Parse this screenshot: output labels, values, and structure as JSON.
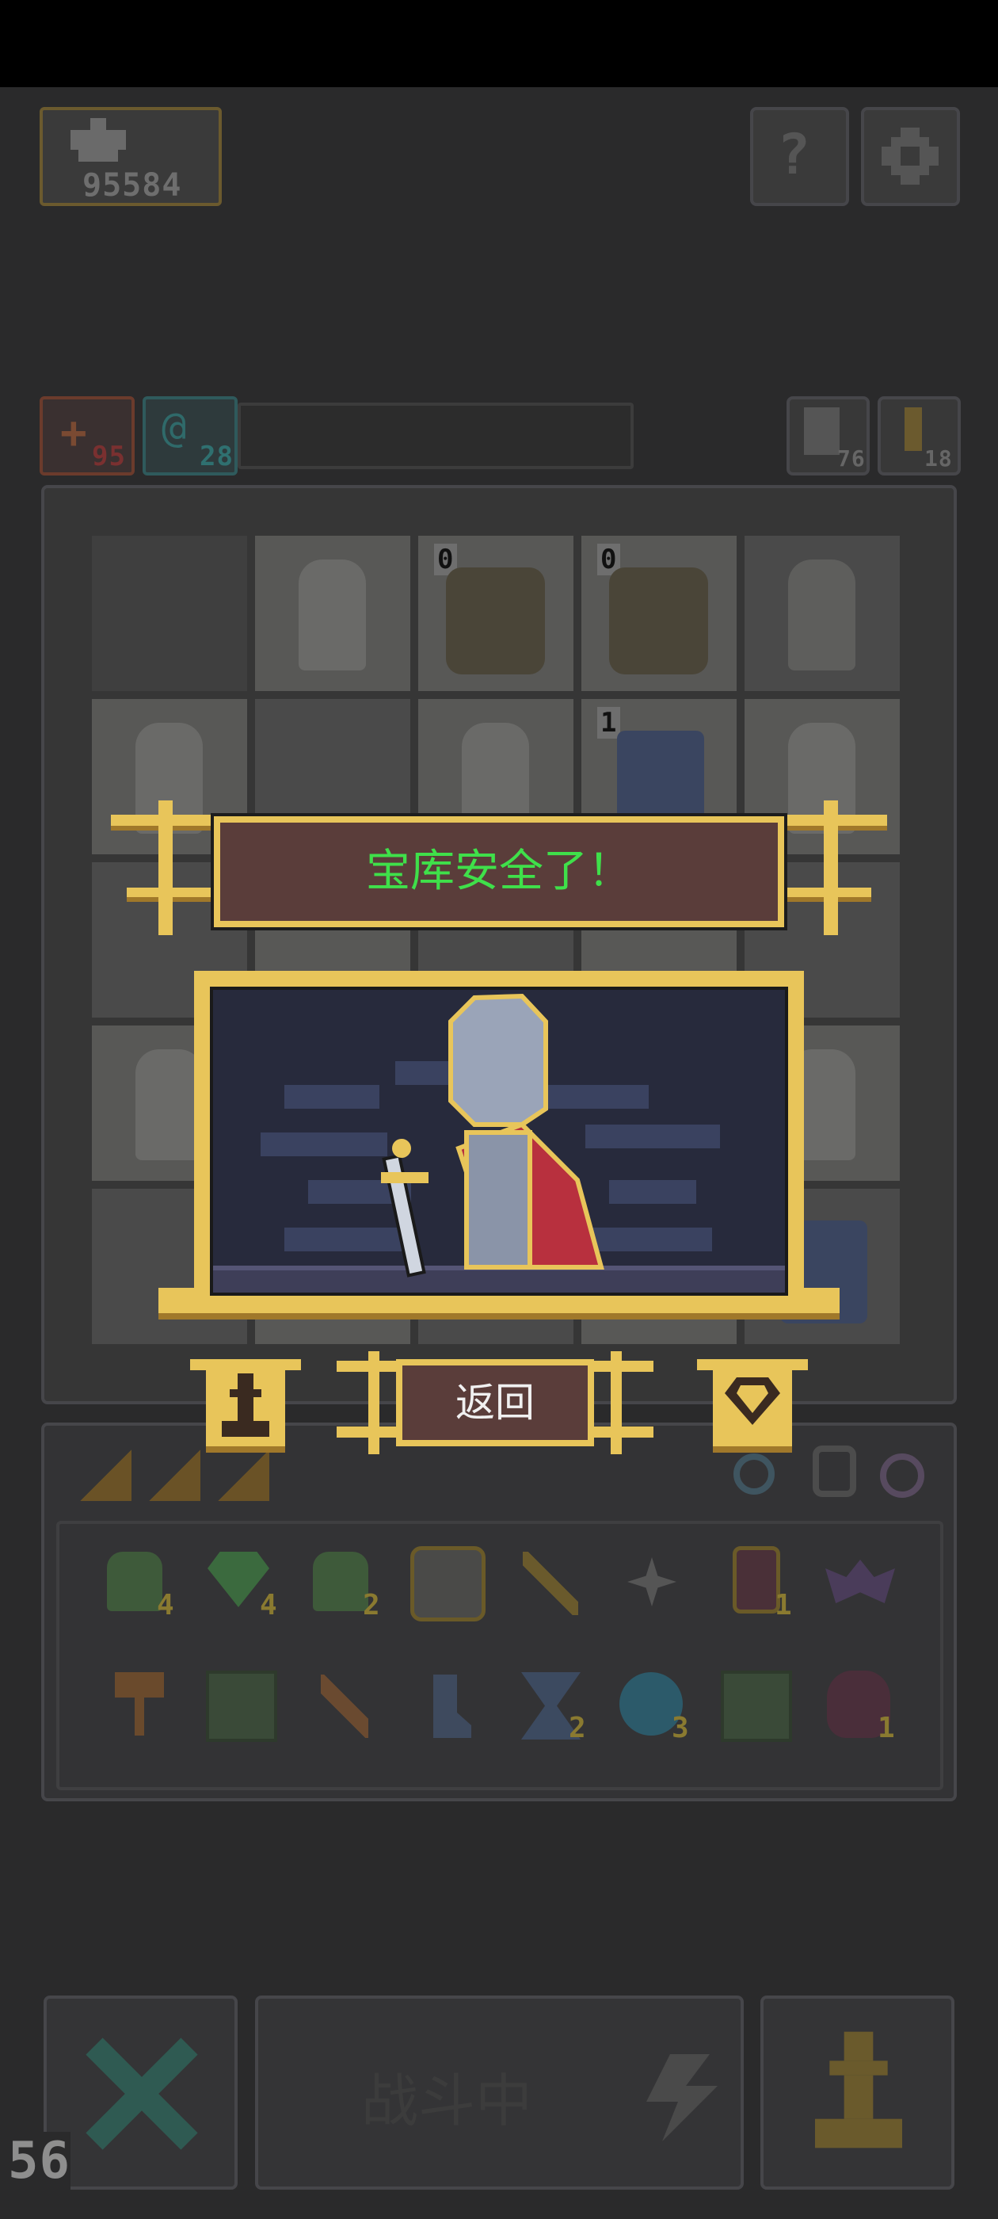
{
  "hud": {
    "score": "95584",
    "hp": "95",
    "mana": "28",
    "stat_a": "76",
    "stat_b": "18"
  },
  "grid": {
    "badge_1": "0",
    "badge_2": "0",
    "badge_3": "1"
  },
  "popup": {
    "title": "宝库安全了！",
    "return_label": "返回"
  },
  "inventory": {
    "row1_counts": [
      "4",
      "4",
      "2",
      "",
      "",
      "",
      "1",
      ""
    ],
    "row2_counts": [
      "",
      "",
      "",
      "",
      "2",
      "3",
      "",
      "1"
    ]
  },
  "bottom": {
    "battle_label": "战斗中",
    "fps": "56"
  },
  "colors": {
    "accent_gold": "#e8c55a",
    "title_green": "#3fe04a",
    "panel_brown": "#5a3d3a"
  }
}
